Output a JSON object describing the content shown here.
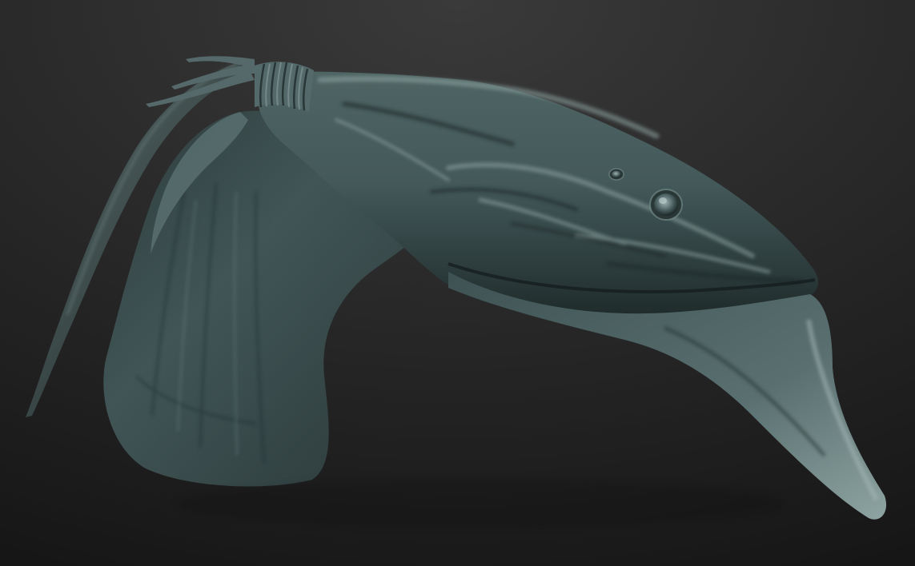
{
  "scene": {
    "colors": {
      "background_top": "#3a3a3a",
      "background_bottom": "#161616",
      "clay_highlight": "#8ea4a2",
      "clay_mid": "#4f6564",
      "clay_shadow": "#1f2b2b"
    }
  }
}
